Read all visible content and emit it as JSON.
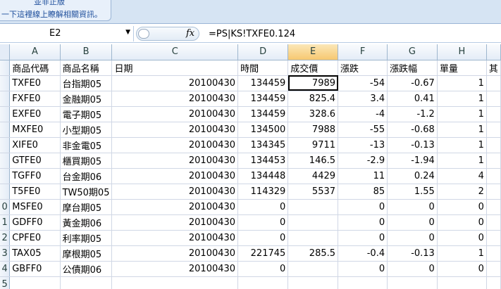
{
  "banner": {
    "line1": "並非正版",
    "line2": "一下這裡線上瞭解相關資訊。"
  },
  "formula_bar": {
    "name_box": "E2",
    "fx_label": "fx",
    "formula": "=PS|KS!TXFE0.124"
  },
  "columns": [
    "A",
    "B",
    "C",
    "D",
    "E",
    "F",
    "G",
    "H"
  ],
  "rows": [
    {
      "hdr": "",
      "cells": [
        "商品代碼",
        "商品名稱",
        "日期",
        "時間",
        "成交價",
        "漲跌",
        "漲跌幅",
        "單量",
        "其"
      ]
    },
    {
      "hdr": "",
      "cells": [
        "TXFE0",
        "台指期05",
        "20100430",
        "134459",
        "7989",
        "-54",
        "-0.67",
        "1",
        ""
      ]
    },
    {
      "hdr": "",
      "cells": [
        "FXFE0",
        "金融期05",
        "20100430",
        "134459",
        "825.4",
        "3.4",
        "0.41",
        "1",
        ""
      ]
    },
    {
      "hdr": "",
      "cells": [
        "EXFE0",
        "電子期05",
        "20100430",
        "134459",
        "328.6",
        "-4",
        "-1.2",
        "1",
        ""
      ]
    },
    {
      "hdr": "",
      "cells": [
        "MXFE0",
        "小型期05",
        "20100430",
        "134500",
        "7988",
        "-55",
        "-0.68",
        "1",
        ""
      ]
    },
    {
      "hdr": "",
      "cells": [
        "XIFE0",
        "非金電05",
        "20100430",
        "134345",
        "9711",
        "-13",
        "-0.13",
        "1",
        ""
      ]
    },
    {
      "hdr": "",
      "cells": [
        "GTFE0",
        "櫃買期05",
        "20100430",
        "134453",
        "146.5",
        "-2.9",
        "-1.94",
        "1",
        ""
      ]
    },
    {
      "hdr": "",
      "cells": [
        "TGFF0",
        "台金期06",
        "20100430",
        "134448",
        "4429",
        "11",
        "0.24",
        "4",
        ""
      ]
    },
    {
      "hdr": "",
      "cells": [
        "T5FE0",
        "TW50期05",
        "20100430",
        "114329",
        "5537",
        "85",
        "1.55",
        "2",
        ""
      ]
    },
    {
      "hdr": "0",
      "cells": [
        "MSFE0",
        "摩台期05",
        "20100430",
        "0",
        "",
        "0",
        "0",
        "0",
        ""
      ]
    },
    {
      "hdr": "1",
      "cells": [
        "GDFF0",
        "黃金期06",
        "20100430",
        "0",
        "",
        "0",
        "0",
        "0",
        ""
      ]
    },
    {
      "hdr": "2",
      "cells": [
        "CPFE0",
        "利率期05",
        "20100430",
        "0",
        "",
        "0",
        "0",
        "0",
        ""
      ]
    },
    {
      "hdr": "3",
      "cells": [
        "TAX05",
        "摩根期05",
        "20100430",
        "221745",
        "285.5",
        "-0.4",
        "-0.13",
        "1",
        ""
      ]
    },
    {
      "hdr": "4",
      "cells": [
        "GBFF0",
        "公債期06",
        "20100430",
        "0",
        "",
        "0",
        "0",
        "0",
        ""
      ]
    },
    {
      "hdr": "5",
      "cells": [
        "",
        "",
        "",
        "",
        "",
        "",
        "",
        "",
        ""
      ]
    }
  ],
  "selected_column": "E",
  "active_cell": {
    "row": 1,
    "col": 4
  }
}
